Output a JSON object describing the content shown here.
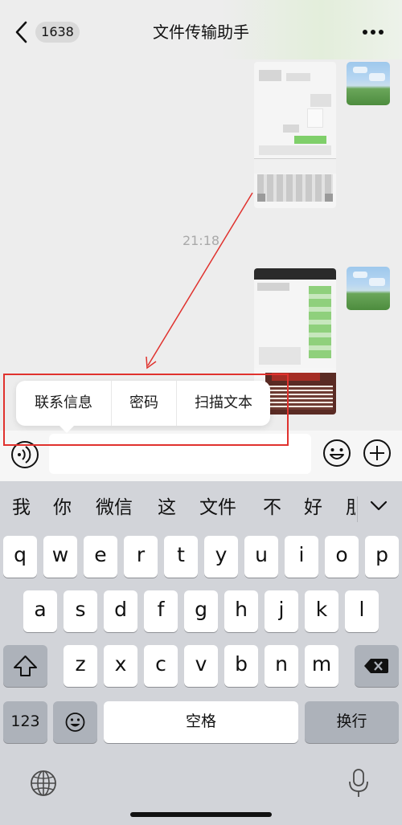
{
  "header": {
    "back_icon": "chevron-left-icon",
    "badge": "1638",
    "title": "文件传输助手",
    "more_icon": "more-dots-icon"
  },
  "chat": {
    "timestamp": "21:18"
  },
  "context_menu": {
    "items": [
      "联系信息",
      "密码",
      "扫描文本"
    ]
  },
  "annotation": {
    "color": "#e0322e"
  },
  "input_bar": {
    "voice_icon": "voice-icon",
    "emoji_icon": "emoji-icon",
    "add_icon": "plus-icon"
  },
  "keyboard": {
    "candidates": [
      "我",
      "你",
      "微信",
      "这",
      "文件",
      "不",
      "好",
      "朋"
    ],
    "row1": [
      "q",
      "w",
      "e",
      "r",
      "t",
      "y",
      "u",
      "i",
      "o",
      "p"
    ],
    "row2": [
      "a",
      "s",
      "d",
      "f",
      "g",
      "h",
      "j",
      "k",
      "l"
    ],
    "row3": [
      "z",
      "x",
      "c",
      "v",
      "b",
      "n",
      "m"
    ],
    "numbers_key": "123",
    "space_key": "空格",
    "return_key": "换行"
  }
}
